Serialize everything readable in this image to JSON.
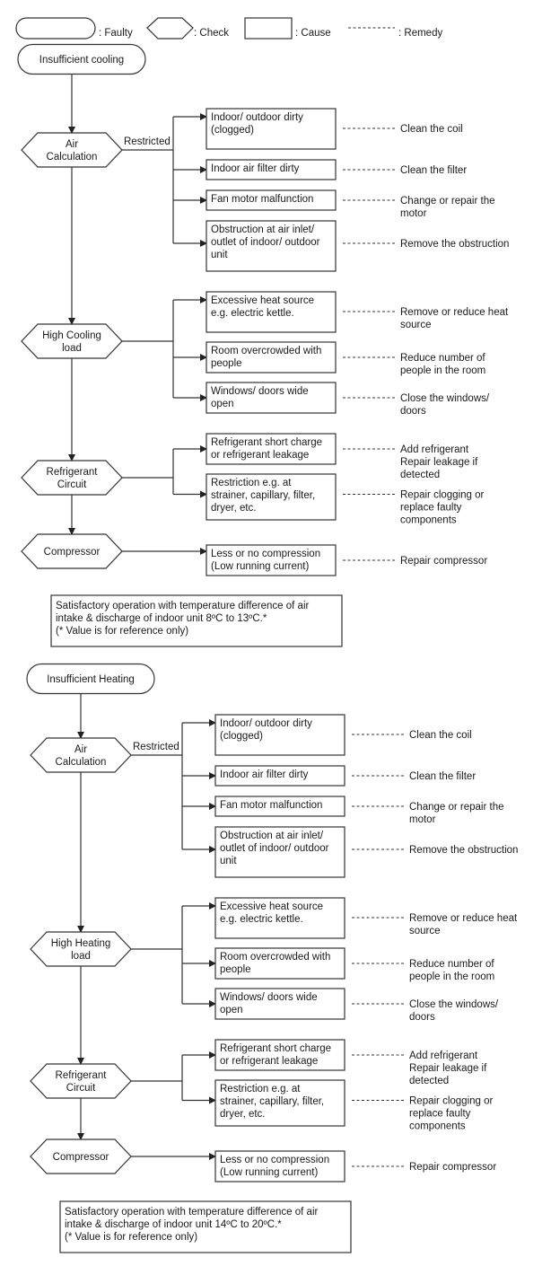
{
  "legend": {
    "faulty": ": Faulty",
    "check": ": Check",
    "cause": ": Cause",
    "remedy": ": Remedy"
  },
  "sections": [
    {
      "id": "cooling",
      "fault": "Insufficient cooling",
      "checks": [
        {
          "label": [
            "Air",
            "Calculation"
          ],
          "branch_label": "Restricted",
          "causes": [
            {
              "text": [
                "Indoor/ outdoor dirty",
                "(clogged)"
              ],
              "remedy": [
                "Clean the coil"
              ]
            },
            {
              "text": [
                "Indoor air filter dirty"
              ],
              "remedy": [
                "Clean the filter"
              ]
            },
            {
              "text": [
                "Fan motor malfunction"
              ],
              "remedy": [
                "Change or repair the",
                "motor"
              ]
            },
            {
              "text": [
                "Obstruction at air inlet/",
                "outlet of indoor/ outdoor",
                "unit"
              ],
              "remedy": [
                "Remove the obstruction"
              ]
            }
          ]
        },
        {
          "label": [
            "High Cooling",
            "load"
          ],
          "branch_label": "",
          "causes": [
            {
              "text": [
                "Excessive heat source",
                "e.g. electric kettle."
              ],
              "remedy": [
                "Remove or reduce heat",
                "source"
              ]
            },
            {
              "text": [
                "Room overcrowded with",
                "people"
              ],
              "remedy": [
                "Reduce number of",
                "people in the room"
              ]
            },
            {
              "text": [
                "Windows/ doors wide",
                "open"
              ],
              "remedy": [
                "Close the windows/",
                "doors"
              ]
            }
          ]
        },
        {
          "label": [
            "Refrigerant",
            "Circuit"
          ],
          "branch_label": "",
          "causes": [
            {
              "text": [
                "Refrigerant short charge",
                "or refrigerant leakage"
              ],
              "remedy": [
                "Add refrigerant",
                "Repair leakage if",
                "detected"
              ]
            },
            {
              "text": [
                "Restriction e.g. at",
                "strainer, capillary, filter,",
                "dryer, etc."
              ],
              "remedy": [
                "Repair clogging or",
                "replace faulty",
                "components"
              ]
            }
          ]
        },
        {
          "label": [
            "Compressor"
          ],
          "branch_label": "",
          "causes": [
            {
              "text": [
                "Less or no compression",
                "(Low running current)"
              ],
              "remedy": [
                "Repair compressor"
              ]
            }
          ]
        }
      ],
      "note": [
        "Satisfactory operation with temperature difference of air",
        "intake & discharge of indoor unit 8ºC to 13ºC.*",
        "(* Value is for reference only)"
      ]
    },
    {
      "id": "heating",
      "fault": "Insufficient Heating",
      "checks": [
        {
          "label": [
            "Air",
            "Calculation"
          ],
          "branch_label": "Restricted",
          "causes": [
            {
              "text": [
                "Indoor/ outdoor dirty",
                "(clogged)"
              ],
              "remedy": [
                "Clean the coil"
              ]
            },
            {
              "text": [
                "Indoor air filter dirty"
              ],
              "remedy": [
                "Clean the filter"
              ]
            },
            {
              "text": [
                "Fan motor malfunction"
              ],
              "remedy": [
                "Change or repair the",
                "motor"
              ]
            },
            {
              "text": [
                "Obstruction at air inlet/",
                "outlet of indoor/ outdoor",
                "unit"
              ],
              "remedy": [
                "Remove the obstruction"
              ]
            }
          ]
        },
        {
          "label": [
            "High Heating",
            "load"
          ],
          "branch_label": "",
          "causes": [
            {
              "text": [
                "Excessive heat source",
                "e.g. electric kettle."
              ],
              "remedy": [
                "Remove or reduce heat",
                "source"
              ]
            },
            {
              "text": [
                "Room overcrowded with",
                "people"
              ],
              "remedy": [
                "Reduce number of",
                "people in the room"
              ]
            },
            {
              "text": [
                "Windows/ doors wide",
                "open"
              ],
              "remedy": [
                "Close the windows/",
                "doors"
              ]
            }
          ]
        },
        {
          "label": [
            "Refrigerant",
            "Circuit"
          ],
          "branch_label": "",
          "causes": [
            {
              "text": [
                "Refrigerant short charge",
                "or refrigerant leakage"
              ],
              "remedy": [
                "Add refrigerant",
                "Repair leakage if",
                "detected"
              ]
            },
            {
              "text": [
                "Restriction e.g. at",
                "strainer, capillary, filter,",
                "dryer, etc."
              ],
              "remedy": [
                "Repair clogging or",
                "replace faulty",
                "components"
              ]
            }
          ]
        },
        {
          "label": [
            "Compressor"
          ],
          "branch_label": "",
          "causes": [
            {
              "text": [
                "Less or no compression",
                "(Low running current)"
              ],
              "remedy": [
                "Repair compressor"
              ]
            }
          ]
        }
      ],
      "note": [
        "Satisfactory operation with temperature difference of air",
        "intake & discharge of indoor unit 14ºC to 20ºC.*",
        "(* Value is for reference only)"
      ]
    }
  ]
}
